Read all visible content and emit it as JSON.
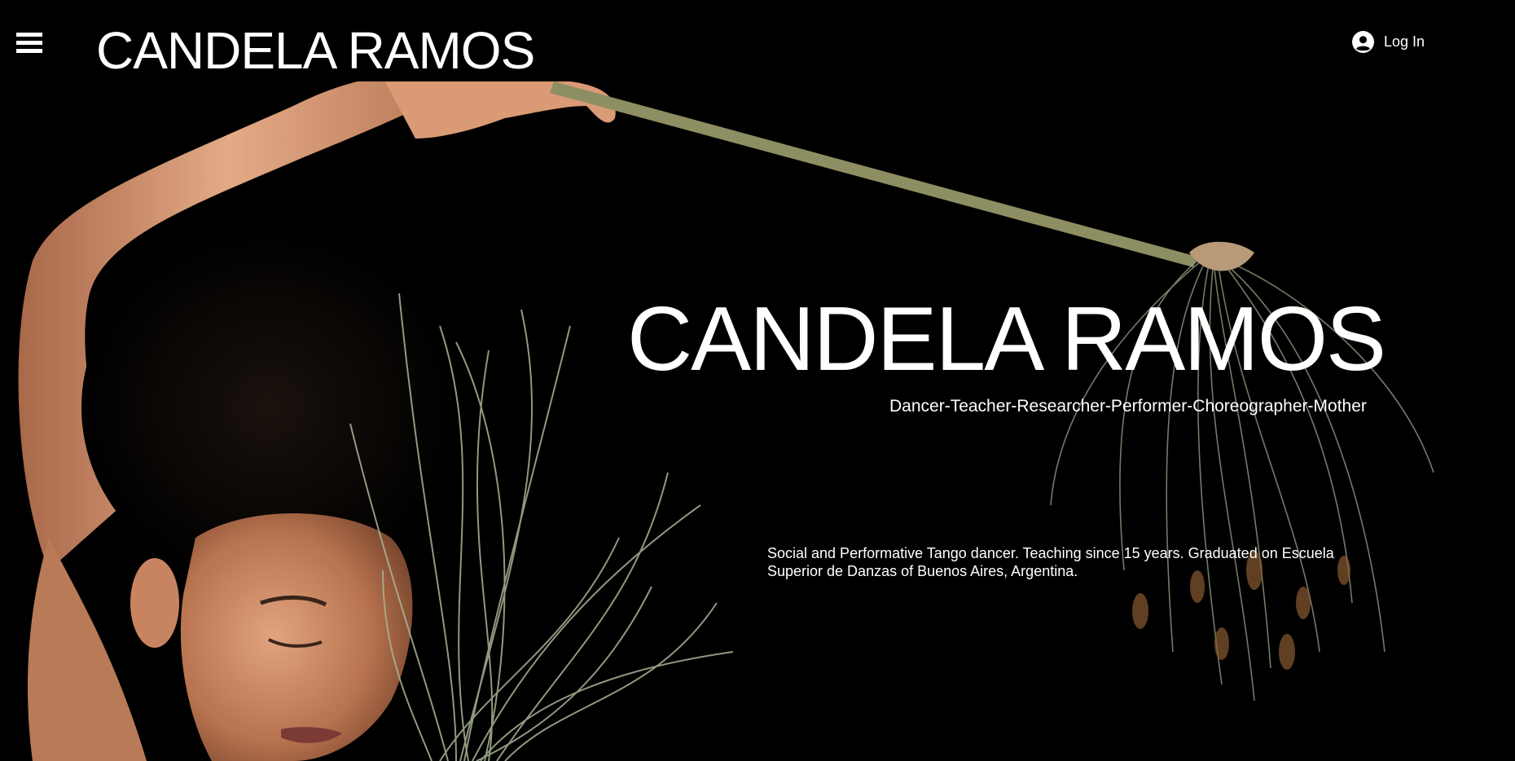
{
  "header": {
    "menu_icon": "hamburger-menu-icon",
    "site_title": "CANDELA RAMOS",
    "login_icon": "user-circle-icon",
    "login_label": "Log In"
  },
  "hero": {
    "title": "CANDELA RAMOS",
    "subtitle": "Dancer-Teacher-Researcher-Performer-Choreographer-Mother",
    "description": "Social and Performative Tango dancer. Teaching since 15 years. Graduated on Escuela Superior de Danzas of Buenos Aires, Argentina."
  },
  "colors": {
    "background": "#000000",
    "text": "#ffffff",
    "skin": "#c98a67",
    "grass": "#9aa88a"
  }
}
